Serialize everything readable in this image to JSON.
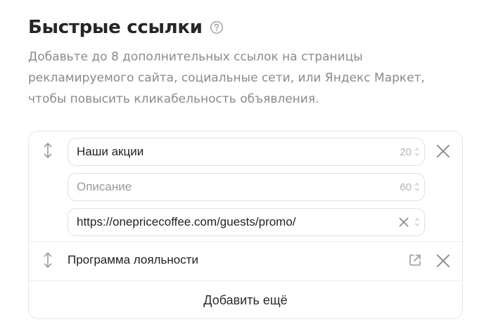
{
  "header": {
    "title": "Быстрые ссылки"
  },
  "description": "Добавьте до 8 дополнительных ссылок на страницы рекламируемого сайта, социальные сети, или Яндекс Маркет, чтобы повысить кликабельность объявления.",
  "links": [
    {
      "title_value": "Наши акции",
      "title_counter": "20",
      "description_placeholder": "Описание",
      "description_value": "",
      "description_counter": "60",
      "url_value": "https://onepricecoffee.com/guests/promo/"
    },
    {
      "title": "Программа лояльности"
    }
  ],
  "add_more_label": "Добавить ещё",
  "icons": {
    "help": "question-circle-icon",
    "drag": "vertical-arrows-icon",
    "remove": "close-icon",
    "clear": "clear-icon",
    "external": "external-link-icon",
    "spinner": "spinner-arrows-icon"
  },
  "colors": {
    "title": "#262626",
    "description": "#8a8a8a",
    "border": "#e6e6e6",
    "icon": "#9a9a9a"
  }
}
